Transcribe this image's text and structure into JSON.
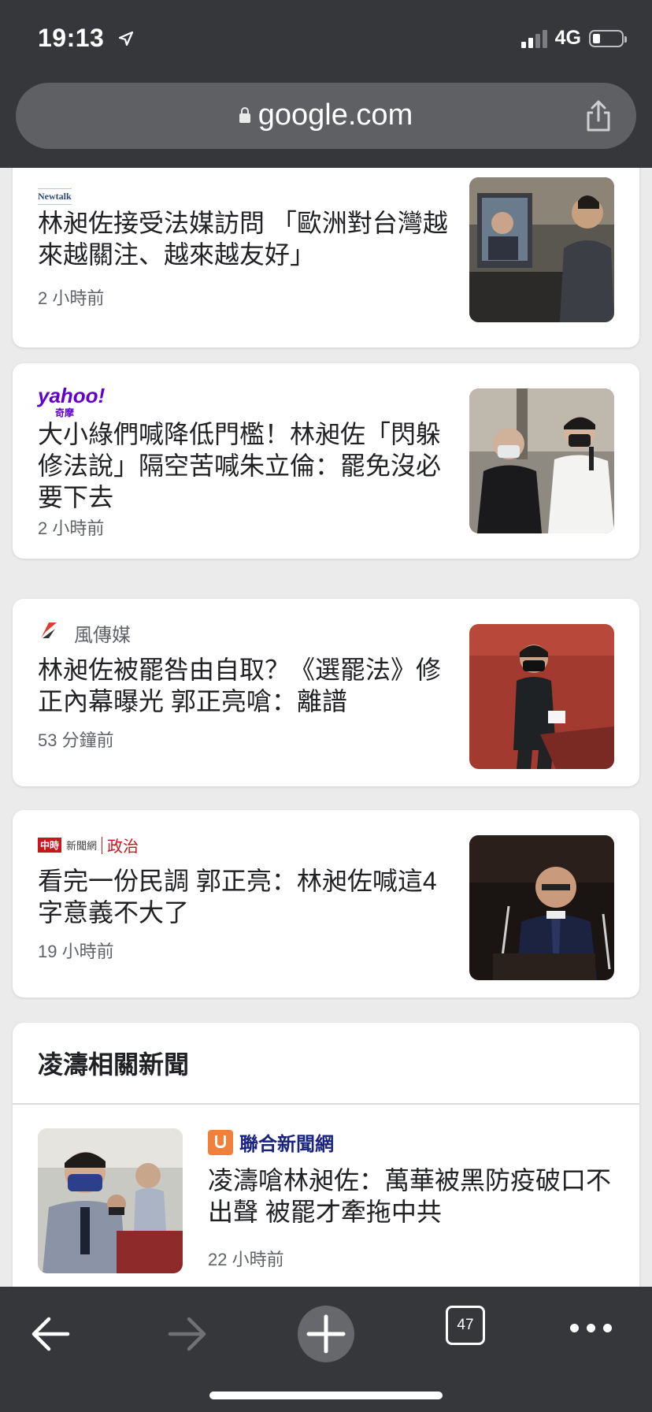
{
  "status_bar": {
    "time": "19:13",
    "network": "4G"
  },
  "browser": {
    "url": "google.com",
    "tab_count": "47"
  },
  "articles": [
    {
      "source": "Newtalk",
      "headline": "林昶佐接受法媒訪問 「歐洲對台灣越來越關注、越來越友好」",
      "time": "2 小時前"
    },
    {
      "source": "yahoo!",
      "source_sub": "奇摩",
      "headline": "大小綠們喊降低門檻！林昶佐「閃躲修法說」隔空苦喊朱立倫：罷免沒必要下去",
      "time": "2 小時前"
    },
    {
      "source": "風傳媒",
      "headline": "林昶佐被罷咎由自取？《選罷法》修正內幕曝光 郭正亮嗆：離譜",
      "time": "53 分鐘前"
    },
    {
      "source_box": "中時",
      "source_news": "新聞網",
      "source_section": "政治",
      "headline": "看完一份民調 郭正亮：林昶佐喊這4字意義不大了",
      "time": "19 小時前"
    }
  ],
  "related": {
    "title": "凌濤相關新聞",
    "source": "聯合新聞網",
    "headline": "凌濤嗆林昶佐：萬華被黑防疫破口不出聲 被罷才牽拖中共",
    "time": "22 小時前"
  }
}
